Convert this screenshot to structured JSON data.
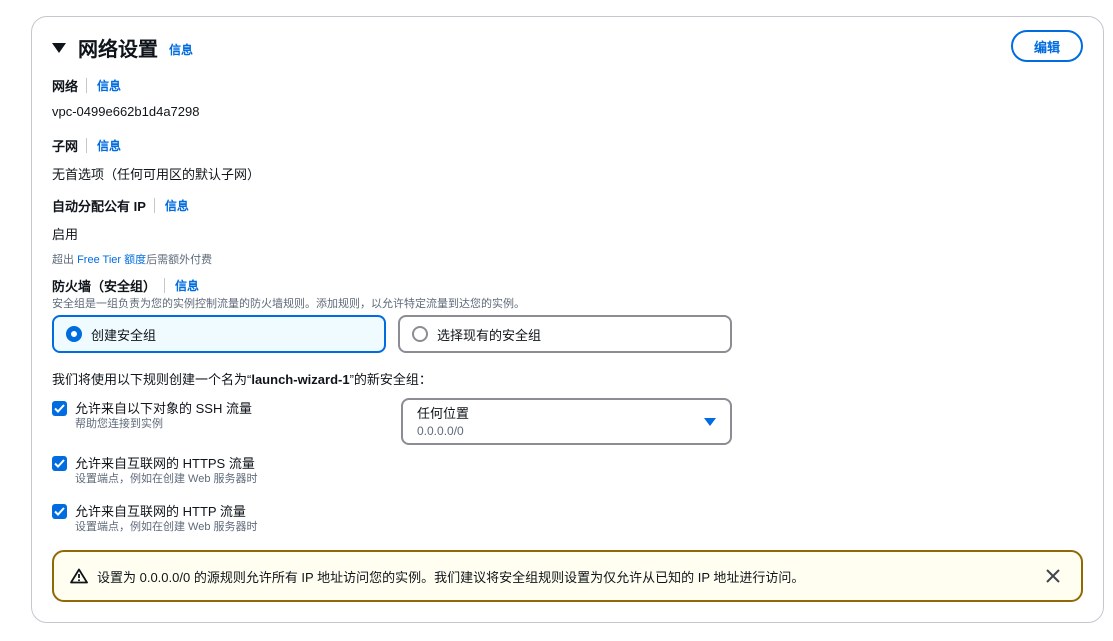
{
  "section": {
    "title": "网络设置",
    "info": "信息",
    "edit_button": "编辑"
  },
  "network": {
    "label": "网络",
    "info": "信息",
    "value": "vpc-0499e662b1d4a7298"
  },
  "subnet": {
    "label": "子网",
    "info": "信息",
    "value": "无首选项（任何可用区的默认子网）"
  },
  "public_ip": {
    "label": "自动分配公有 IP",
    "info": "信息",
    "value": "启用",
    "note_prefix": "超出 ",
    "note_link": "Free Tier 额度",
    "note_suffix": "后需额外付费"
  },
  "firewall": {
    "label": "防火墙（安全组）",
    "info": "信息",
    "description": "安全组是一组负责为您的实例控制流量的防火墙规则。添加规则，以允许特定流量到达您的实例。",
    "options": [
      {
        "label": "创建安全组",
        "selected": true
      },
      {
        "label": "选择现有的安全组",
        "selected": false
      }
    ],
    "rules_intro_prefix": "我们将使用以下规则创建一个名为“",
    "rules_intro_name": "launch-wizard-1",
    "rules_intro_suffix": "”的新安全组：",
    "rules": [
      {
        "label": "允许来自以下对象的 SSH 流量",
        "desc": "帮助您连接到实例",
        "checked": true
      },
      {
        "label": "允许来自互联网的 HTTPS 流量",
        "desc": "设置端点，例如在创建 Web 服务器时",
        "checked": true
      },
      {
        "label": "允许来自互联网的 HTTP 流量",
        "desc": "设置端点，例如在创建 Web 服务器时",
        "checked": true
      }
    ],
    "ssh_source": {
      "selected": "任何位置",
      "cidr": "0.0.0.0/0"
    }
  },
  "alert": {
    "text": "设置为 0.0.0.0/0 的源规则允许所有 IP 地址访问您的实例。我们建议将安全组规则设置为仅允许从已知的 IP 地址进行访问。",
    "icon": "warning-icon"
  },
  "colors": {
    "accent": "#006ce0",
    "warning_border": "#906806",
    "warning_bg": "#fffef0"
  }
}
